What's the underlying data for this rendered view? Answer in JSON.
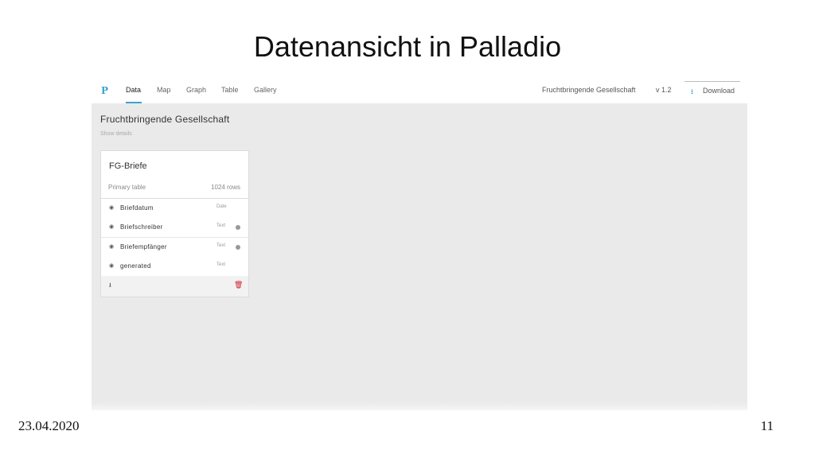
{
  "slide": {
    "title": "Datenansicht in Palladio",
    "date": "23.04.2020",
    "page": "11"
  },
  "app": {
    "logo": "P",
    "tabs": [
      "Data",
      "Map",
      "Graph",
      "Table",
      "Gallery"
    ],
    "active_tab": "Data",
    "project_name": "Fruchtbringende Gesellschaft",
    "version": "v 1.2",
    "download_label": "Download",
    "accent_color": "#3ba3d0"
  },
  "project": {
    "title": "Fruchtbringende Gesellschaft",
    "details_link": "Show details"
  },
  "table_card": {
    "title": "FG-Briefe",
    "subtitle": "Primary table",
    "rows": "1024 rows",
    "fields": [
      {
        "name": "Briefdatum",
        "type": "Date",
        "dot": false
      },
      {
        "name": "Briefschreiber",
        "type": "Text",
        "dot": true
      },
      {
        "name": "Briefempfänger",
        "type": "Text",
        "dot": true
      },
      {
        "name": "generated",
        "type": "Text",
        "dot": false
      }
    ],
    "delete_color": "#cc2233"
  }
}
